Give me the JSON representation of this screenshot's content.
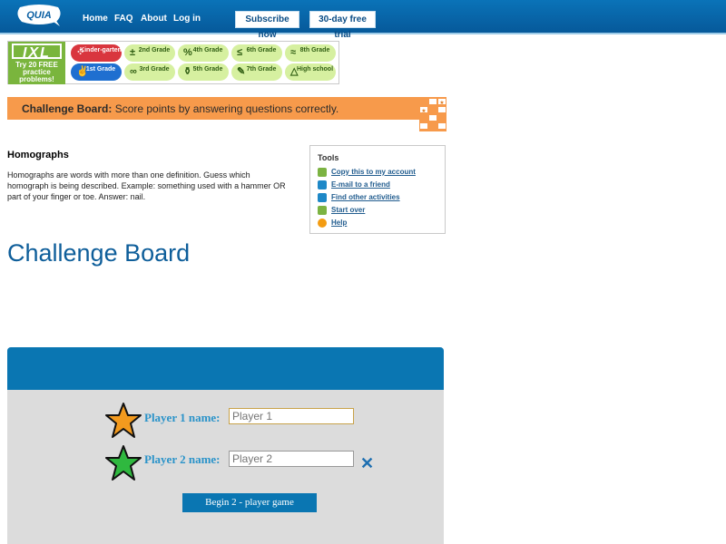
{
  "topnav": {
    "logo_text": "QUIA",
    "links": [
      "Home",
      "FAQ",
      "About",
      "Log in"
    ],
    "subscribe_label": "Subscribe now",
    "trial_label": "30-day free trial"
  },
  "ixl": {
    "logo": "IXL",
    "tagline": "Try 20 FREE practice problems!",
    "grades": [
      {
        "label": "Kinder-garten",
        "symbol": "⁘",
        "style": "red"
      },
      {
        "label": "2nd Grade",
        "symbol": "±",
        "style": "green"
      },
      {
        "label": "4th Grade",
        "symbol": "%",
        "style": "green"
      },
      {
        "label": "6th Grade",
        "symbol": "≤",
        "style": "green"
      },
      {
        "label": "8th Grade",
        "symbol": "≈",
        "style": "green"
      },
      {
        "label": "1st Grade",
        "symbol": "✌",
        "style": "blue"
      },
      {
        "label": "3rd Grade",
        "symbol": "∞",
        "style": "green"
      },
      {
        "label": "5th Grade",
        "symbol": "⚱",
        "style": "green"
      },
      {
        "label": "7th Grade",
        "symbol": "✎",
        "style": "green"
      },
      {
        "label": "High school",
        "symbol": "△",
        "style": "green"
      }
    ]
  },
  "challenge_header": {
    "bold": "Challenge Board:",
    "text": "Score points by answering questions correctly."
  },
  "activity": {
    "title": "Homographs",
    "description": "Homographs are words with more than one definition. Guess which homograph is being described. Example: something used with a hammer OR part of your finger or toe. Answer: nail."
  },
  "tools": {
    "title": "Tools",
    "items": [
      {
        "label": "Copy this to my account",
        "icon": "copy-icon",
        "color": "#7cb342"
      },
      {
        "label": "E-mail to a friend",
        "icon": "email-icon",
        "color": "#1e88c7"
      },
      {
        "label": "Find other activities",
        "icon": "find-icon",
        "color": "#1e88c7"
      },
      {
        "label": "Start over",
        "icon": "start-over-icon",
        "color": "#7cb342"
      },
      {
        "label": "Help",
        "icon": "help-icon",
        "color": "#f39c12"
      }
    ]
  },
  "page_title": "Challenge Board",
  "game": {
    "player1_label": "Player 1 name:",
    "player1_placeholder": "Player 1",
    "player2_label": "Player 2 name:",
    "player2_placeholder": "Player 2",
    "begin_label": "Begin 2 - player game",
    "colors": {
      "player1_star": "#f39a1e",
      "player2_star": "#2fb83f",
      "panel_header": "#0a76b2",
      "panel_bg": "#dcdcdc"
    }
  }
}
